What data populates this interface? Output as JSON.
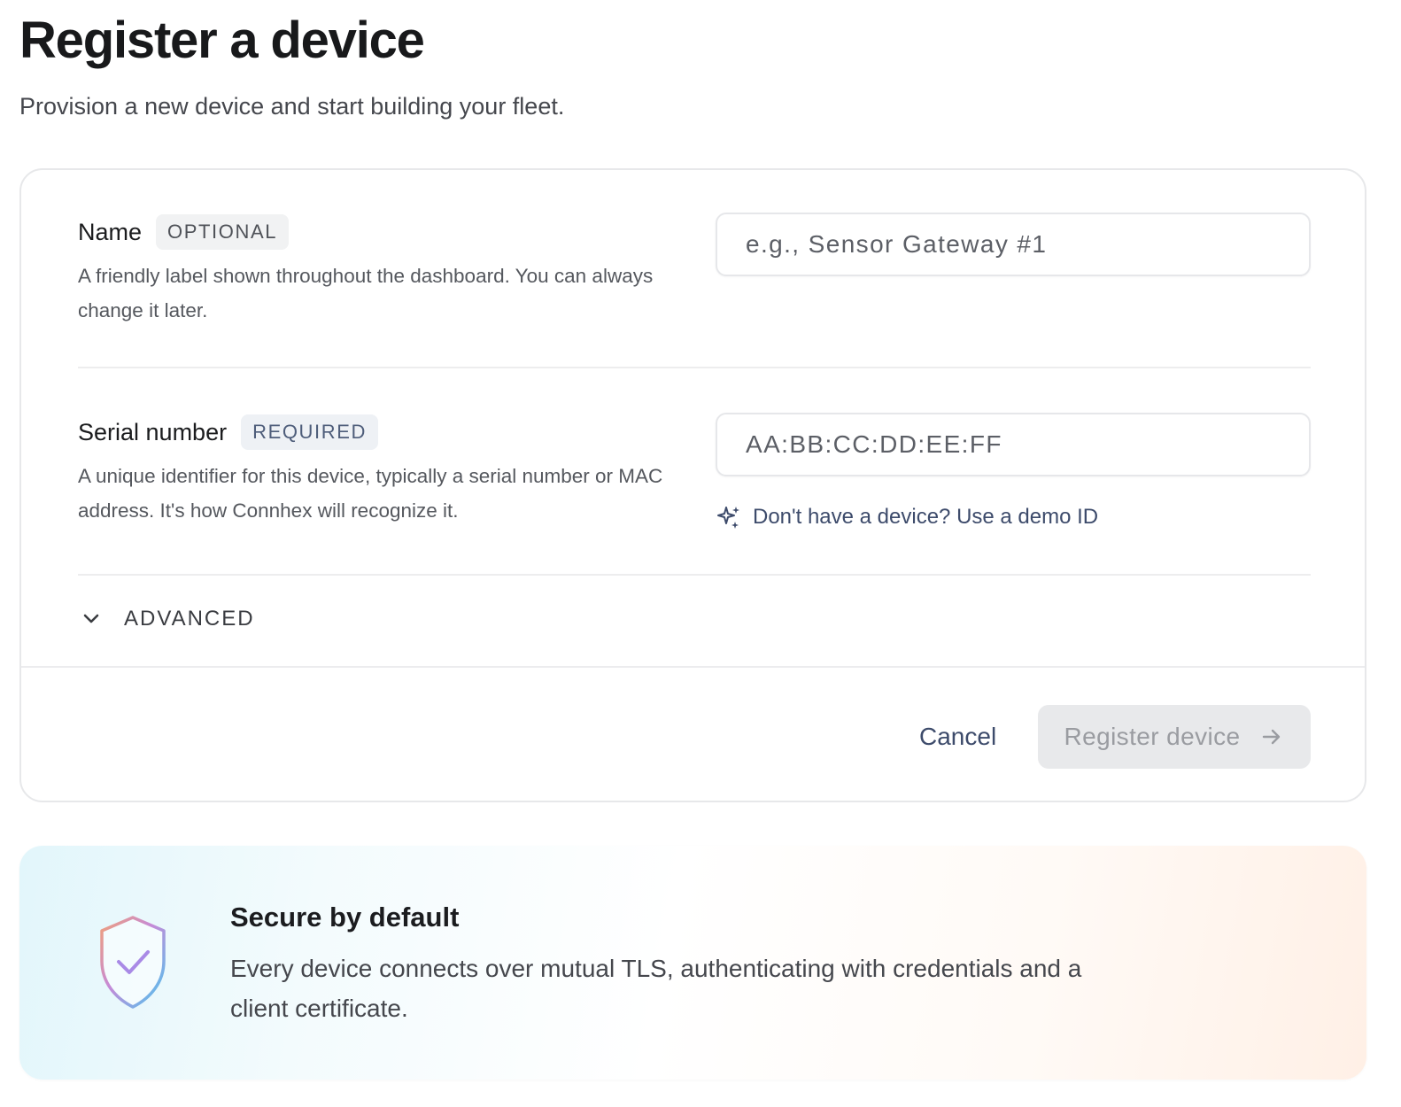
{
  "header": {
    "title": "Register a device",
    "subtitle": "Provision a new device and start building your fleet."
  },
  "form": {
    "name": {
      "label": "Name",
      "badge": "OPTIONAL",
      "description": "A friendly label shown throughout the dashboard. You can always change it later.",
      "placeholder": "e.g., Sensor Gateway #1",
      "value": ""
    },
    "serial": {
      "label": "Serial number",
      "badge": "REQUIRED",
      "description": "A unique identifier for this device, typically a serial number or MAC address. It's how Connhex will recognize it.",
      "placeholder": "AA:BB:CC:DD:EE:FF",
      "value": "",
      "demo_link": "Don't have a device? Use a demo ID"
    },
    "advanced_label": "ADVANCED"
  },
  "footer": {
    "cancel_label": "Cancel",
    "register_label": "Register device"
  },
  "banner": {
    "title": "Secure by default",
    "body": "Every device connects over mutual TLS, authenticating with credentials and a client certificate."
  },
  "icons": {
    "demo": "sparkle-icon",
    "advanced": "chevron-down-icon",
    "register": "arrow-right-icon",
    "banner": "shield-check-icon"
  },
  "colors": {
    "accent": "#3d4b6b",
    "disabled_button_bg": "#e8e9eb",
    "disabled_button_text": "#9a9ca1"
  }
}
